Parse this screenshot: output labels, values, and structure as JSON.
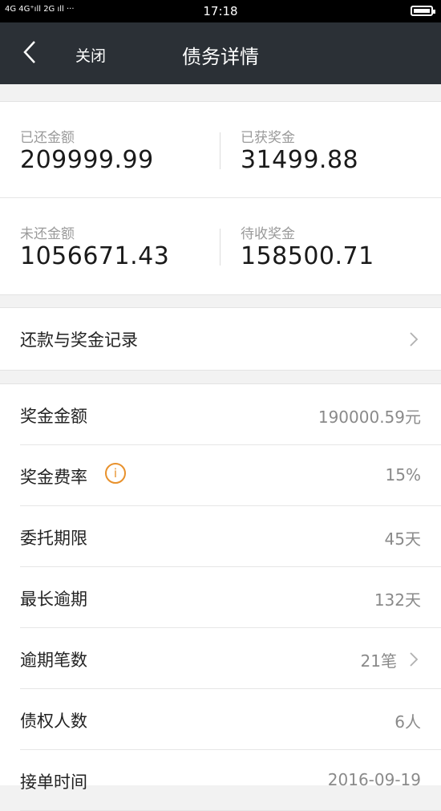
{
  "status_bar": {
    "signal": "4G 4G⁺ıll 2G ıll ···",
    "time": "17:18"
  },
  "nav": {
    "back_icon": "chevron-left-icon",
    "close_label": "关闭",
    "title": "债务详情"
  },
  "summary": {
    "repaid_label": "已还金额",
    "repaid_value": "209999.99",
    "earned_bonus_label": "已获奖金",
    "earned_bonus_value": "31499.88",
    "unpaid_label": "未还金额",
    "unpaid_value": "1056671.43",
    "pending_bonus_label": "待收奖金",
    "pending_bonus_value": "158500.71"
  },
  "records": {
    "label": "还款与奖金记录",
    "icon": "chevron-right-icon"
  },
  "details": [
    {
      "label": "奖金金额",
      "value": "190000.59元"
    },
    {
      "label": "奖金费率",
      "value": "15%",
      "icon": "info-icon",
      "icon_text": "i"
    },
    {
      "label": "委托期限",
      "value": "45天"
    },
    {
      "label": "最长逾期",
      "value": "132天"
    },
    {
      "label": "逾期笔数",
      "value": "21笔",
      "icon": "chevron-right-icon"
    },
    {
      "label": "债权人数",
      "value": "6人"
    },
    {
      "label": "接单时间",
      "value": "2016-09-19"
    }
  ],
  "colors": {
    "status_bar_bg": "#000000",
    "nav_bg": "#2b3036",
    "page_bg": "#f2f2f2",
    "info_accent": "#e8912c"
  }
}
